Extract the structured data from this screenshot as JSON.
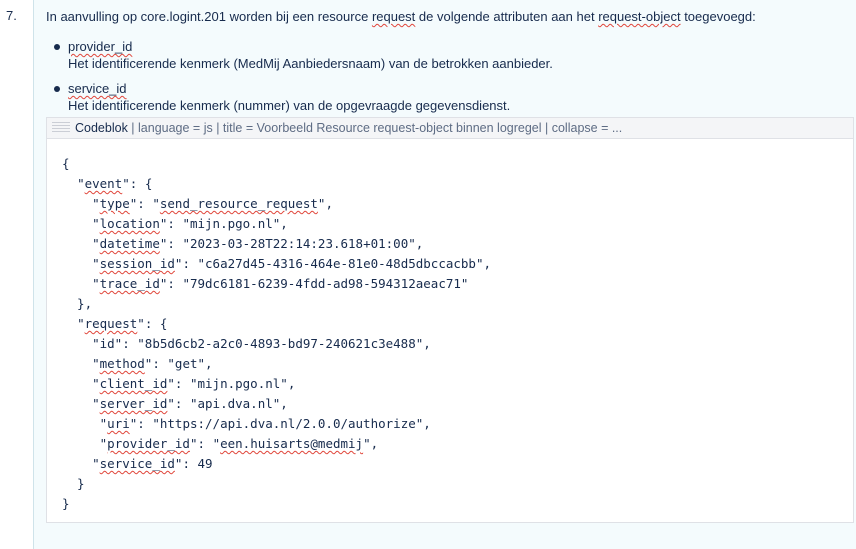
{
  "step": {
    "number": "7.",
    "intro": {
      "before_resource": "In aanvulling op core.logint.201 worden bij een resource ",
      "request_word": "request",
      "middle": " de volgende attributen aan het ",
      "request_object": "request-object",
      "after": " toegevoegd:"
    },
    "bullets": [
      {
        "term": "provider_id",
        "description": "Het identificerende kenmerk (MedMij Aanbiedersnaam) van de betrokken aanbieder."
      },
      {
        "term": "service_id",
        "description": "Het identificerende kenmerk (nummer) van de opgevraagde gegevensdienst."
      }
    ]
  },
  "codeblock": {
    "macro_name": "Codeblok",
    "macro_params": " | language = js | title = Voorbeeld Resource request-object binnen logregel | collapse = ...",
    "lines": [
      "{",
      "  \"event\": {",
      "    \"type\": \"send_resource_request\",",
      "    \"location\": \"mijn.pgo.nl\",",
      "    \"datetime\": \"2023-03-28T22:14:23.618+01:00\",",
      "    \"session_id\": \"c6a27d45-4316-464e-81e0-48d5dbccacbb\",",
      "    \"trace_id\": \"79dc6181-6239-4fdd-ad98-594312aeac71\"",
      "  },",
      "  \"request\": {",
      "    \"id\": \"8b5d6cb2-a2c0-4893-bd97-240621c3e488\",",
      "    \"method\": \"get\",",
      "    \"client_id\": \"mijn.pgo.nl\",",
      "    \"server_id\": \"api.dva.nl\",",
      "     \"uri\": \"https://api.dva.nl/2.0.0/authorize\",",
      "     \"provider_id\": \"een.huisarts@medmij\",",
      "    \"service_id\": 49",
      "  }",
      "}"
    ]
  },
  "colors": {
    "text": "#172b4d",
    "spellcheck_underline": "#e0453a",
    "cell_background": "#f4fbfd",
    "macro_header_background": "#f4f5f7"
  },
  "icons": {
    "macro": "codeblock-macro-icon",
    "bullet": "bullet-dot"
  }
}
